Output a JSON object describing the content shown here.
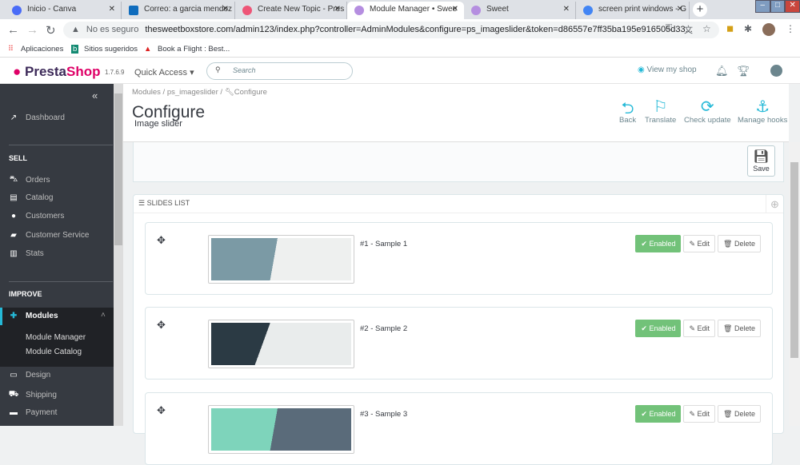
{
  "browser": {
    "tabs": [
      {
        "title": "Inicio - Canva",
        "color": "#4a6cf7"
      },
      {
        "title": "Correo: a garcia mendoz",
        "color": "#0f6cbd"
      },
      {
        "title": "Create New Topic - Pres",
        "color": "#e57"
      },
      {
        "title": "Module Manager • Swee",
        "color": "#b58ee0"
      },
      {
        "title": "Sweet",
        "color": "#b58ee0"
      },
      {
        "title": "screen print windows - G",
        "color": "#4285f4"
      }
    ],
    "active_tab": 3,
    "security": "No es seguro",
    "url": "thesweetboxstore.com/admin123/index.php?controller=AdminModules&configure=ps_imageslider&token=d86557e7ff35ba195e916505d33...",
    "bookmarks": [
      "Aplicaciones",
      "Sitios sugeridos",
      "Book a Flight : Best..."
    ]
  },
  "header": {
    "logo": "PrestaShop",
    "version": "1.7.6.9",
    "quick_access": "Quick Access ▾",
    "search_placeholder": "Search",
    "view_shop": "View my shop"
  },
  "sidebar": {
    "dashboard": "Dashboard",
    "sell_title": "SELL",
    "sell": [
      "Orders",
      "Catalog",
      "Customers",
      "Customer Service",
      "Stats"
    ],
    "improve_title": "IMPROVE",
    "modules": "Modules",
    "modules_sub": [
      "Module Manager",
      "Module Catalog"
    ],
    "improve": [
      "Design",
      "Shipping",
      "Payment"
    ]
  },
  "page": {
    "breadcrumb": [
      "Modules",
      "ps_imageslider",
      "Configure"
    ],
    "title": "Configure",
    "subtitle": "Image slider",
    "toolbar": [
      "Back",
      "Translate",
      "Check update",
      "Manage hooks"
    ],
    "save": "Save"
  },
  "slides": {
    "title": "SLIDES LIST",
    "items": [
      {
        "name": "#1 - Sample 1",
        "status": "Enabled",
        "colors": [
          "#7b9aa5",
          "#eef0ef"
        ]
      },
      {
        "name": "#2 - Sample 2",
        "status": "Enabled",
        "colors": [
          "#2b3a44",
          "#e9ecec"
        ]
      },
      {
        "name": "#3 - Sample 3",
        "status": "Enabled",
        "colors": [
          "#7ed4bb",
          "#5a6b7a"
        ]
      }
    ],
    "edit": "Edit",
    "delete": "Delete"
  }
}
